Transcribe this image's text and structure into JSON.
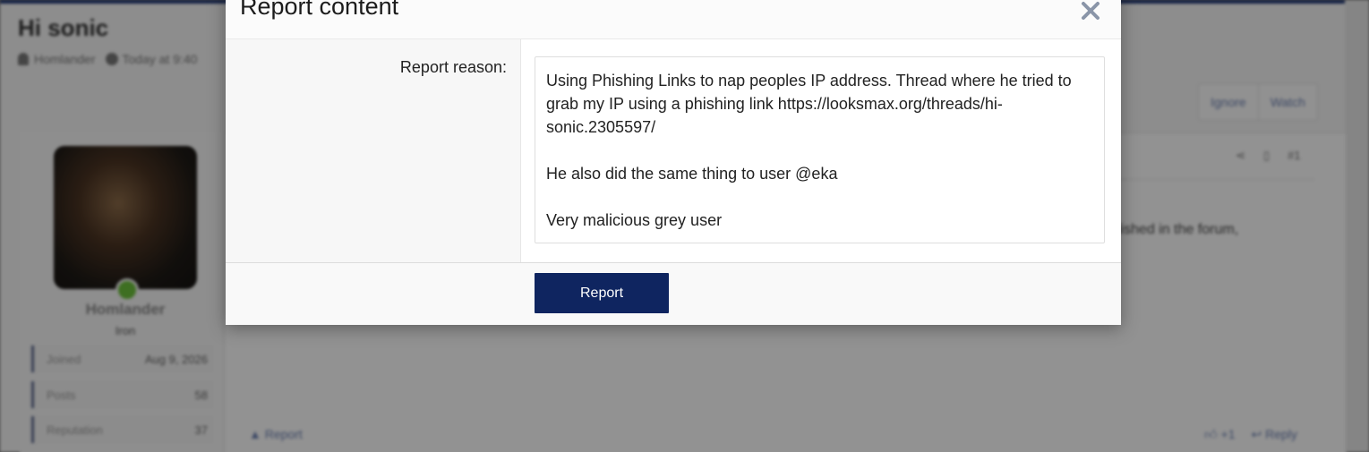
{
  "background": {
    "thread_title": "Hi sonic",
    "author": "Homlander",
    "post_time": "Today at 9:40",
    "ignore_label": "Ignore",
    "watch_label": "Watch",
    "user_title": "Iron",
    "stats": [
      {
        "label": "Joined",
        "value": "Aug 9, 2026"
      },
      {
        "label": "Posts",
        "value": "58"
      },
      {
        "label": "Reputation",
        "value": "37"
      }
    ],
    "post_number": "#1",
    "body_fragment": "lished in the forum,",
    "report_link": "Report",
    "like_count": "+1",
    "reply_label": "Reply"
  },
  "modal": {
    "title": "Report content",
    "field_label": "Report reason:",
    "reason_text": "Using Phishing Links to nap peoples IP address. Thread where he tried to grab my IP using a phishing link https://looksmax.org/threads/hi-sonic.2305597/\n\nHe also did the same thing to user @eka\n\nVery malicious grey user",
    "submit_label": "Report"
  },
  "colors": {
    "accent": "#0f2560",
    "close_icon": "#8a95a8"
  }
}
